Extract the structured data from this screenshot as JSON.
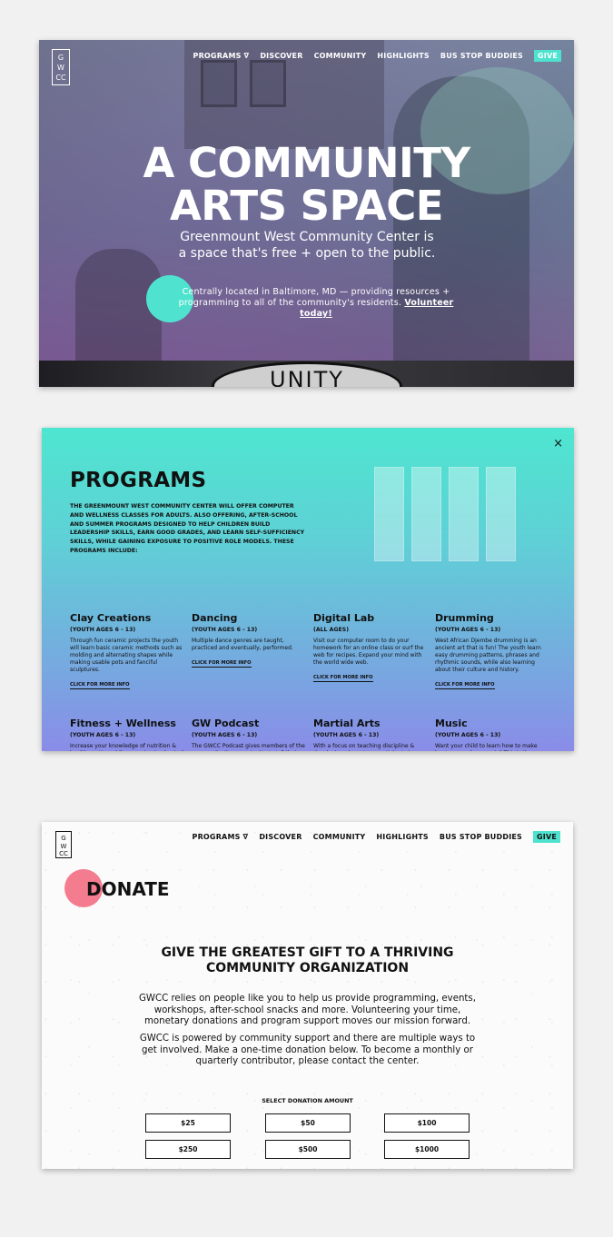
{
  "nav": {
    "logo_lines": [
      "G",
      "W",
      "CC"
    ],
    "items": [
      "PROGRAMS ∇",
      "DISCOVER",
      "COMMUNITY",
      "HIGHLIGHTS",
      "BUS STOP BUDDIES"
    ],
    "give_label": "GIVE"
  },
  "hero": {
    "title_lines": [
      "A COMMUNITY",
      "ARTS SPACE"
    ],
    "subtitle": "Greenmount West Community Center is a space that's free + open to the public.",
    "small_text": "Centrally located in Baltimore, MD — providing resources + programming to all of the community's residents.",
    "volunteer_link": "Volunteer today!",
    "banner_text": "UNITY"
  },
  "programs": {
    "close_label": "×",
    "heading": "PROGRAMS",
    "intro": "THE GREENMOUNT WEST COMMUNITY CENTER WILL OFFER COMPUTER AND WELLNESS CLASSES FOR ADULTS. ALSO OFFERING, AFTER-SCHOOL AND SUMMER PROGRAMS DESIGNED TO HELP CHILDREN BUILD LEADERSHIP SKILLS, EARN GOOD GRADES, AND LEARN SELF-SUFFICIENCY SKILLS, WHILE GAINING EXPOSURE TO POSITIVE ROLE MODELS. THESE PROGRAMS INCLUDE:",
    "link_label": "CLICK FOR MORE INFO",
    "items": [
      {
        "title": "Clay Creations",
        "ages": "(YOUTH AGES 6 - 13)",
        "desc": "Through fun ceramic projects the youth will learn basic ceramic methods such as molding and alternating shapes while making usable pots and fanciful sculptures."
      },
      {
        "title": "Dancing",
        "ages": "(YOUTH AGES 6 - 13)",
        "desc": "Multiple dance genres are taught, practiced and eventually, performed."
      },
      {
        "title": "Digital Lab",
        "ages": "(ALL AGES)",
        "desc": "Visit our computer room to do your homework for an online class or surf the web for recipes. Expand your mind with the world wide web."
      },
      {
        "title": "Drumming",
        "ages": "(YOUTH AGES 6 - 13)",
        "desc": "West African Djembe drumming is an ancient art that is fun! The youth learn easy drumming patterns, phrases and rhythmic sounds, while also learning about their culture and history."
      },
      {
        "title": "Fitness + Wellness",
        "ages": "(YOUTH AGES 6 - 13)",
        "desc": "Increase your knowledge of nutrition & healthy eating while engaging in physical activity for increase healthy living."
      },
      {
        "title": "GW Podcast",
        "ages": "(YOUTH AGES 6 - 13)",
        "desc": "The GWCC Podcast gives members of the community the opportunity to tell their stories, interview others and hear their voices."
      },
      {
        "title": "Martial Arts",
        "ages": "(YOUTH AGES 6 - 13)",
        "desc": "With a focus on teaching discipline & developing character, martial arts is a fun way for the youth to gain self-respect, self-control and self-"
      },
      {
        "title": "Music",
        "ages": "(YOUTH AGES 6 - 13)",
        "desc": "Want your child to learn how to make beats or produce music? This is the program for them."
      }
    ]
  },
  "donate": {
    "heading": "DONATE",
    "subheading": "GIVE THE GREATEST GIFT TO A THRIVING COMMUNITY ORGANIZATION",
    "para1": "GWCC relies on people like you to help us provide programming, events, workshops, after-school snacks and more. Volunteering your time, monetary donations and program support moves our mission forward.",
    "para2": "GWCC is powered by community support and there are multiple ways to get involved. Make a one-time donation below. To become a monthly or quarterly contributor, please contact the center.",
    "amount_label": "SELECT DONATION AMOUNT",
    "amounts": [
      "$25",
      "$50",
      "$100",
      "$250",
      "$500",
      "$1000"
    ]
  },
  "colors": {
    "accent_teal": "#4fe3cf",
    "accent_pink": "#f37c8f",
    "programs_gradient_top": "#4ee6d0",
    "programs_gradient_bottom": "#8a8ce8"
  }
}
